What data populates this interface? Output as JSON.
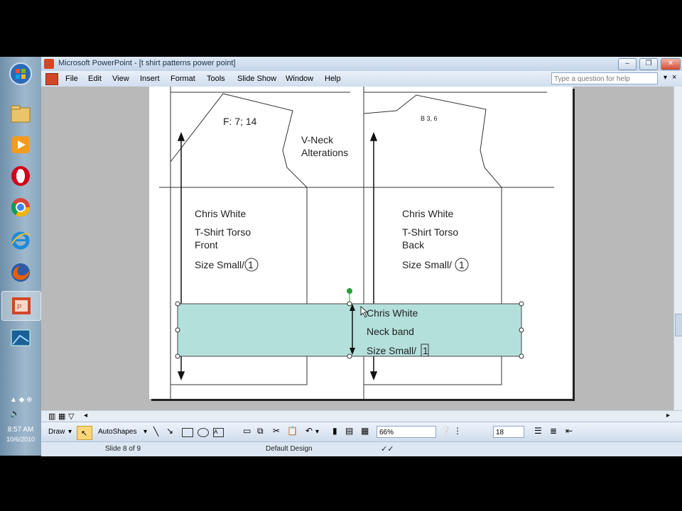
{
  "window": {
    "title": "Microsoft PowerPoint - [t shirt patterns power point]"
  },
  "menu": [
    "File",
    "Edit",
    "View",
    "Insert",
    "Format",
    "Tools",
    "Slide Show",
    "Window",
    "Help"
  ],
  "help_placeholder": "Type a question for help",
  "window_controls": {
    "minimize": "–",
    "restore": "❐",
    "close": "✕"
  },
  "slide": {
    "front": {
      "label": "F: 7; 14",
      "name": "Chris White",
      "piece1": "T-Shirt Torso",
      "piece2": "Front",
      "size": "Size Small/",
      "size_num": "1"
    },
    "alterations": {
      "line1": "V-Neck",
      "line2": "Alterations"
    },
    "back": {
      "label": "B 3, 6",
      "name": "Chris White",
      "piece1": "T-Shirt Torso",
      "piece2": "Back",
      "size": "Size Small/",
      "size_num": "1"
    },
    "neckband": {
      "name": "Chris White",
      "piece": "Neck band",
      "size": "Size Small/",
      "size_num": "1"
    }
  },
  "drawbar": {
    "draw": "Draw",
    "autoshapes": "AutoShapes",
    "zoom": "66%",
    "font_size": "18"
  },
  "status": {
    "slide": "Slide 8 of 9",
    "design": "Default Design"
  },
  "taskbar": {
    "time": "8:57 AM",
    "date": "10/6/2010"
  },
  "colors": {
    "selected_fill": "#b4e0dc",
    "selection_handle": "#2a9d3a"
  }
}
